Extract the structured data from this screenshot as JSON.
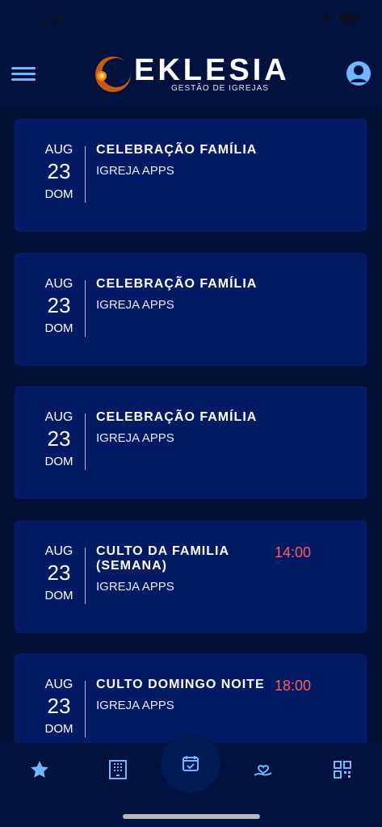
{
  "status": {
    "time": "1:57"
  },
  "header": {
    "brand": "EKLESIA",
    "subtitle": "GESTÃO DE IGREJAS"
  },
  "events": [
    {
      "month": "AUG",
      "day": "23",
      "dow": "DOM",
      "title": "CELEBRAÇÃO FAMÍLIA",
      "church": "IGREJA APPS",
      "time": ""
    },
    {
      "month": "AUG",
      "day": "23",
      "dow": "DOM",
      "title": "CELEBRAÇÃO FAMÍLIA",
      "church": "IGREJA APPS",
      "time": ""
    },
    {
      "month": "AUG",
      "day": "23",
      "dow": "DOM",
      "title": "CELEBRAÇÃO FAMÍLIA",
      "church": "IGREJA APPS",
      "time": ""
    },
    {
      "month": "AUG",
      "day": "23",
      "dow": "DOM",
      "title": "CULTO DA FAMILIA (SEMANA)",
      "church": "IGREJA APPS",
      "time": "14:00"
    },
    {
      "month": "AUG",
      "day": "23",
      "dow": "DOM",
      "title": "CULTO DOMINGO NOITE",
      "church": "IGREJA APPS",
      "time": "18:00"
    }
  ],
  "nav": [
    {
      "icon": "star-icon"
    },
    {
      "icon": "building-icon"
    },
    {
      "icon": "calendar-check-icon"
    },
    {
      "icon": "hand-heart-icon"
    },
    {
      "icon": "qr-code-icon"
    }
  ],
  "colors": {
    "background": "#00123d",
    "card": "#031a64",
    "accent": "#6fb7ff",
    "time": "#ff5a5a"
  }
}
